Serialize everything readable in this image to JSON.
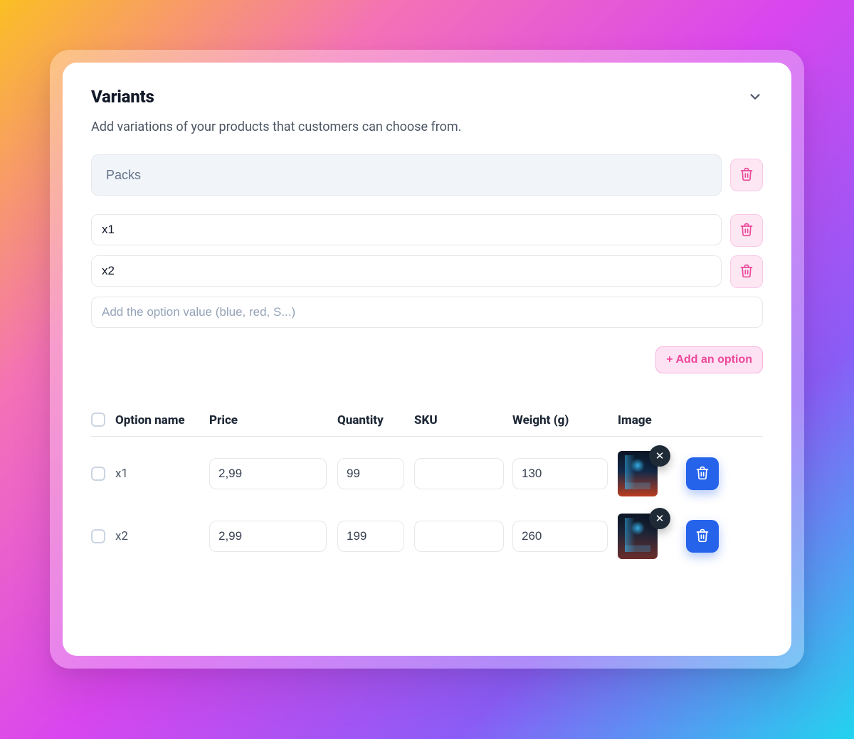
{
  "card": {
    "title": "Variants",
    "subtitle": "Add variations of your products that customers can choose from."
  },
  "option": {
    "name": "Packs",
    "values": [
      "x1",
      "x2"
    ],
    "new_value_placeholder": "Add the option value (blue, red, S...)",
    "add_option_label": "+ Add an option"
  },
  "table": {
    "columns": {
      "option_name": "Option name",
      "price": "Price",
      "quantity": "Quantity",
      "sku": "SKU",
      "weight": "Weight (g)",
      "image": "Image"
    },
    "rows": [
      {
        "name": "x1",
        "price": "2,99",
        "quantity": "99",
        "sku": "",
        "weight": "130"
      },
      {
        "name": "x2",
        "price": "2,99",
        "quantity": "199",
        "sku": "",
        "weight": "260"
      }
    ]
  },
  "icons": {
    "trash": "trash-icon",
    "chevron_down": "chevron-down-icon",
    "close": "close-icon"
  }
}
